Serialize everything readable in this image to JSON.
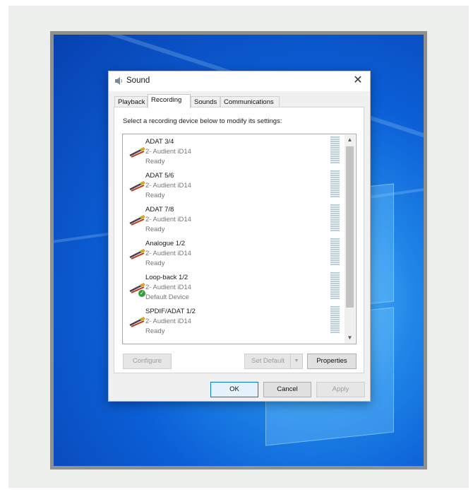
{
  "window": {
    "title": "Sound",
    "close_symbol": "✕"
  },
  "tabs": [
    {
      "label": "Playback",
      "active": false
    },
    {
      "label": "Recording",
      "active": true
    },
    {
      "label": "Sounds",
      "active": false
    },
    {
      "label": "Communications",
      "active": false
    }
  ],
  "instruction": "Select a recording device below to modify its settings:",
  "devices": [
    {
      "name": "ADAT 3/4",
      "driver": "2- Audient iD14",
      "status": "Ready",
      "icon": "cable-icon",
      "is_default": false
    },
    {
      "name": "ADAT 5/6",
      "driver": "2- Audient iD14",
      "status": "Ready",
      "icon": "cable-icon",
      "is_default": false
    },
    {
      "name": "ADAT 7/8",
      "driver": "2- Audient iD14",
      "status": "Ready",
      "icon": "cable-icon",
      "is_default": false
    },
    {
      "name": "Analogue 1/2",
      "driver": "2- Audient iD14",
      "status": "Ready",
      "icon": "cable-icon",
      "is_default": false
    },
    {
      "name": "Loop-back 1/2",
      "driver": "2- Audient iD14",
      "status": "Default Device",
      "icon": "cable-icon",
      "is_default": true
    },
    {
      "name": "SPDIF/ADAT 1/2",
      "driver": "2- Audient iD14",
      "status": "Ready",
      "icon": "cable-icon",
      "is_default": false
    }
  ],
  "buttons": {
    "configure": "Configure",
    "set_default": "Set Default",
    "properties": "Properties",
    "ok": "OK",
    "cancel": "Cancel",
    "apply": "Apply"
  },
  "colors": {
    "accent": "#0078d7",
    "default_check": "#2e9e3e",
    "desktop_blue": "#0b5fd6"
  }
}
